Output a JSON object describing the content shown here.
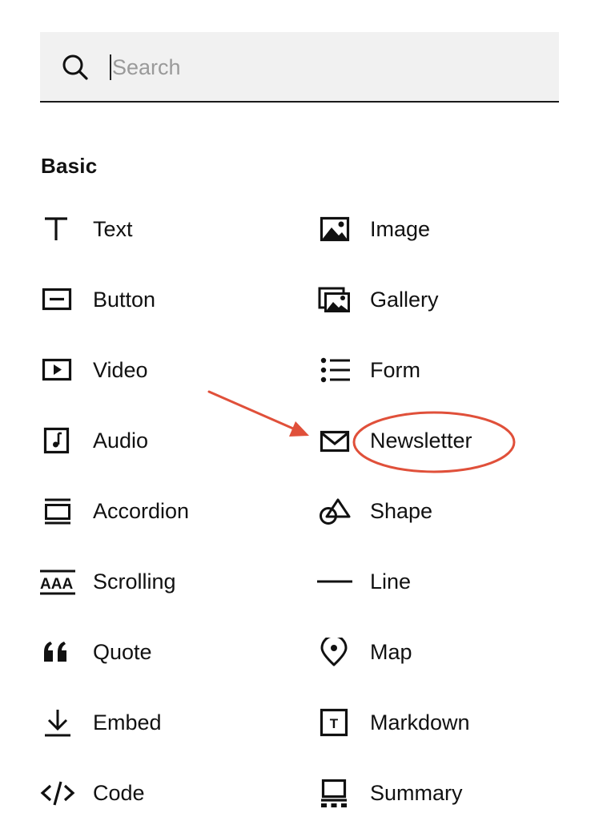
{
  "search": {
    "placeholder": "Search",
    "value": ""
  },
  "section": {
    "title": "Basic"
  },
  "blocks": {
    "text": {
      "label": "Text",
      "icon": "text-icon"
    },
    "image": {
      "label": "Image",
      "icon": "image-icon"
    },
    "button": {
      "label": "Button",
      "icon": "button-icon"
    },
    "gallery": {
      "label": "Gallery",
      "icon": "gallery-icon"
    },
    "video": {
      "label": "Video",
      "icon": "video-icon"
    },
    "form": {
      "label": "Form",
      "icon": "form-icon"
    },
    "audio": {
      "label": "Audio",
      "icon": "audio-icon"
    },
    "newsletter": {
      "label": "Newsletter",
      "icon": "newsletter-icon"
    },
    "accordion": {
      "label": "Accordion",
      "icon": "accordion-icon"
    },
    "shape": {
      "label": "Shape",
      "icon": "shape-icon"
    },
    "scrolling": {
      "label": "Scrolling",
      "icon": "scrolling-icon",
      "icon_text": "AAA"
    },
    "line": {
      "label": "Line",
      "icon": "line-icon"
    },
    "quote": {
      "label": "Quote",
      "icon": "quote-icon"
    },
    "map": {
      "label": "Map",
      "icon": "map-pin-icon"
    },
    "embed": {
      "label": "Embed",
      "icon": "embed-icon"
    },
    "markdown": {
      "label": "Markdown",
      "icon": "markdown-icon",
      "icon_text": "T"
    },
    "code": {
      "label": "Code",
      "icon": "code-icon"
    },
    "summary": {
      "label": "Summary",
      "icon": "summary-icon"
    }
  },
  "annotation": {
    "color": "#e0503a",
    "target": "newsletter"
  },
  "colors": {
    "search_bg": "#f1f1f1",
    "text": "#111111",
    "placeholder": "#9a9a9a",
    "annotation": "#e0503a"
  }
}
